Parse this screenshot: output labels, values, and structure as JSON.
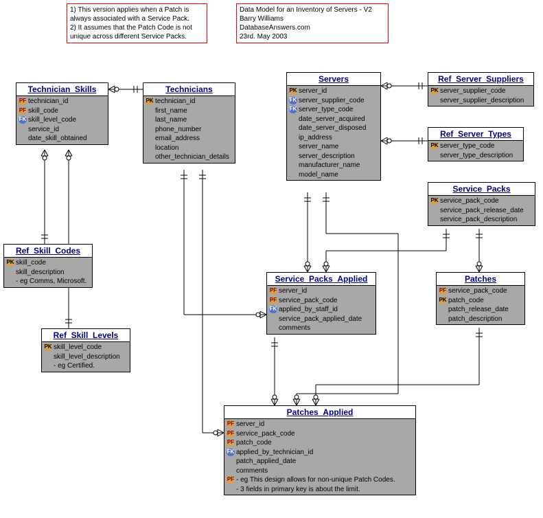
{
  "notes": {
    "note1": {
      "line1": "1) This version applies when a Patch is",
      "line2": "always associated with a Service Pack.",
      "line3": "2) It assumes that the Patch Code is not",
      "line4": "unique across different Service Packs."
    },
    "note2": {
      "line1": "Data Model for an Inventory of Servers - V2",
      "line2": "Barry Williams",
      "line3": "DatabaseAnswers.com",
      "line4": "23rd. May 2003"
    }
  },
  "entities": {
    "technician_skills": {
      "title": "Technician_Skills",
      "fields": [
        {
          "key": "PF",
          "name": "technician_id"
        },
        {
          "key": "PF",
          "name": "skill_code"
        },
        {
          "key": "FK",
          "name": "skill_level_code"
        },
        {
          "key": "",
          "name": "service_id"
        },
        {
          "key": "",
          "name": "date_skill_obtained"
        }
      ]
    },
    "technicians": {
      "title": "Technicians",
      "fields": [
        {
          "key": "PK",
          "name": "technician_id"
        },
        {
          "key": "",
          "name": "first_name"
        },
        {
          "key": "",
          "name": "last_name"
        },
        {
          "key": "",
          "name": "phone_number"
        },
        {
          "key": "",
          "name": "email_address"
        },
        {
          "key": "",
          "name": "location"
        },
        {
          "key": "",
          "name": "other_technician_details"
        }
      ]
    },
    "servers": {
      "title": "Servers",
      "fields": [
        {
          "key": "PK",
          "name": "server_id"
        },
        {
          "key": "FK",
          "name": "server_supplier_code"
        },
        {
          "key": "FK",
          "name": "server_type_code"
        },
        {
          "key": "",
          "name": "date_server_acquired"
        },
        {
          "key": "",
          "name": "date_server_disposed"
        },
        {
          "key": "",
          "name": "ip_address"
        },
        {
          "key": "",
          "name": "server_name"
        },
        {
          "key": "",
          "name": "server_description"
        },
        {
          "key": "",
          "name": "manufacturer_name"
        },
        {
          "key": "",
          "name": "model_name"
        }
      ]
    },
    "ref_server_suppliers": {
      "title": "Ref_Server_Suppliers",
      "fields": [
        {
          "key": "PK",
          "name": "server_supplier_code"
        },
        {
          "key": "",
          "name": "server_supplier_description"
        }
      ]
    },
    "ref_server_types": {
      "title": "Ref_Server_Types",
      "fields": [
        {
          "key": "PK",
          "name": "server_type_code"
        },
        {
          "key": "",
          "name": "server_type_description"
        }
      ]
    },
    "service_packs": {
      "title": "Service_Packs",
      "fields": [
        {
          "key": "PK",
          "name": "service_pack_code"
        },
        {
          "key": "",
          "name": "service_pack_release_date"
        },
        {
          "key": "",
          "name": "service_pack_description"
        }
      ]
    },
    "ref_skill_codes": {
      "title": "Ref_Skill_Codes",
      "fields": [
        {
          "key": "PK",
          "name": "skill_code"
        },
        {
          "key": "",
          "name": "skill_description"
        },
        {
          "key": "",
          "name": "- eg Comms, Microsoft."
        }
      ]
    },
    "ref_skill_levels": {
      "title": "Ref_Skill_Levels",
      "fields": [
        {
          "key": "PK",
          "name": "skill_level_code"
        },
        {
          "key": "",
          "name": "skill_level_description"
        },
        {
          "key": "",
          "name": "- eg Certified."
        }
      ]
    },
    "service_packs_applied": {
      "title": "Service_Packs_Applied",
      "fields": [
        {
          "key": "PF",
          "name": "server_id"
        },
        {
          "key": "PF",
          "name": "service_pack_code"
        },
        {
          "key": "FK",
          "name": "applied_by_staff_id"
        },
        {
          "key": "",
          "name": "service_pack_applied_date"
        },
        {
          "key": "",
          "name": "comments"
        }
      ]
    },
    "patches": {
      "title": "Patches",
      "fields": [
        {
          "key": "PF",
          "name": "service_pack_code"
        },
        {
          "key": "PK",
          "name": "patch_code"
        },
        {
          "key": "",
          "name": "patch_release_date"
        },
        {
          "key": "",
          "name": "patch_description"
        }
      ]
    },
    "patches_applied": {
      "title": "Patches_Applied",
      "fields": [
        {
          "key": "PF",
          "name": "server_id"
        },
        {
          "key": "PF",
          "name": "service_pack_code"
        },
        {
          "key": "PF",
          "name": "patch_code"
        },
        {
          "key": "FK",
          "name": "applied_by_technician_id"
        },
        {
          "key": "",
          "name": "patch_applied_date"
        },
        {
          "key": "",
          "name": "comments"
        },
        {
          "key": "PF",
          "name": "- eg This design allows for non-unique Patch Codes."
        },
        {
          "key": "",
          "name": "- 3 fields in primary key is about the limit."
        }
      ]
    }
  }
}
